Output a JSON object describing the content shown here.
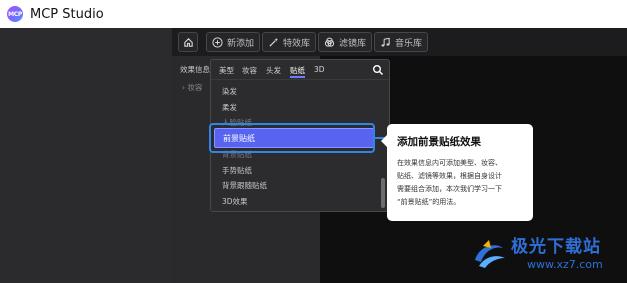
{
  "app": {
    "logo_text": "MCP",
    "title": "MCP Studio"
  },
  "toolbar": {
    "buttons": [
      {
        "label": "",
        "icon": "home-icon"
      },
      {
        "label": "新添加",
        "icon": "plus-circle-icon"
      },
      {
        "label": "特效库",
        "icon": "magic-wand-icon"
      },
      {
        "label": "滤镜库",
        "icon": "filter-icon"
      },
      {
        "label": "音乐库",
        "icon": "music-note-icon"
      }
    ]
  },
  "side_panel": {
    "label": "效果信息",
    "row": "› 妆容"
  },
  "dropdown": {
    "tabs": [
      "美型",
      "妆容",
      "头发",
      "贴纸",
      "3D"
    ],
    "active_tab": "贴纸",
    "items": [
      "染发",
      "柔发",
      "人脸贴纸",
      "前景贴纸",
      "背景贴纸",
      "手势贴纸",
      "背景跟随贴纸",
      "3D效果"
    ],
    "selected_item": "前景贴纸"
  },
  "tooltip": {
    "title": "添加前景贴纸效果",
    "lines": [
      "在效果信息内可添加美型、妆容、",
      "贴纸、滤镜等效果，根据自身设计",
      "需要组合添加，本次我们学习一下",
      "“前景贴纸”的用法。"
    ]
  },
  "watermark": {
    "title": "极光下载站",
    "url": "www.xz7.com"
  },
  "colors": {
    "accent": "#5864f0",
    "focus": "#2f86e8",
    "background": "#1e1e20"
  }
}
